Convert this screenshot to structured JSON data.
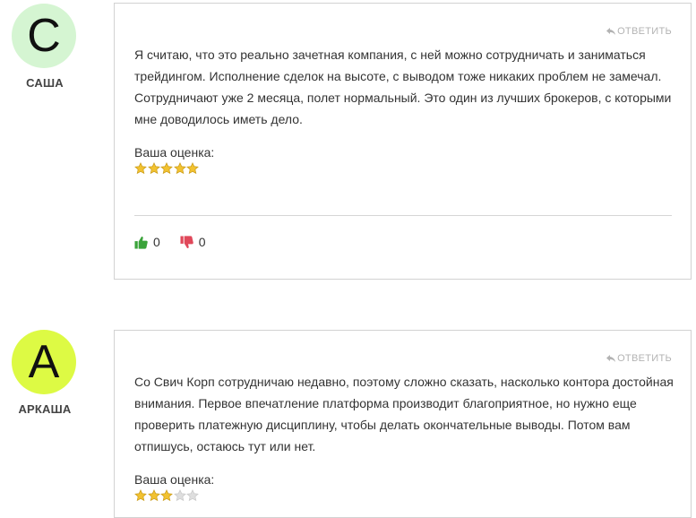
{
  "reviews": [
    {
      "avatar_letter": "С",
      "avatar_color": "#d5f5d2",
      "author": "САША",
      "reply_label": "ОТВЕТИТЬ",
      "text": "Я считаю, что это реально зачетная компания, с ней можно сотрудничать и заниматься трейдингом. Исполнение сделок на высоте, с выводом тоже никаких проблем не замечал. Сотрудничают уже 2 месяца, полет нормальный. Это один из лучших брокеров, с которыми мне доводилось иметь дело.",
      "rating_label": "Ваша оценка:",
      "rating": 5,
      "rating_max": 5,
      "likes": "0",
      "dislikes": "0"
    },
    {
      "avatar_letter": "А",
      "avatar_color": "#ddfa44",
      "author": "АРКАША",
      "reply_label": "ОТВЕТИТЬ",
      "text": "Со Свич Корп сотрудничаю недавно, поэтому сложно сказать, насколько контора достойная внимания. Первое впечатление платформа производит благоприятное, но нужно еще проверить платежную дисциплину, чтобы делать окончательные выводы. Потом вам отпишусь, остаюсь тут или нет.",
      "rating_label": "Ваша оценка:",
      "rating": 3,
      "rating_max": 5
    }
  ],
  "colors": {
    "star_filled": "#f2c230",
    "star_empty": "#dedede",
    "like": "#3aa33a",
    "dislike": "#e0485a"
  }
}
